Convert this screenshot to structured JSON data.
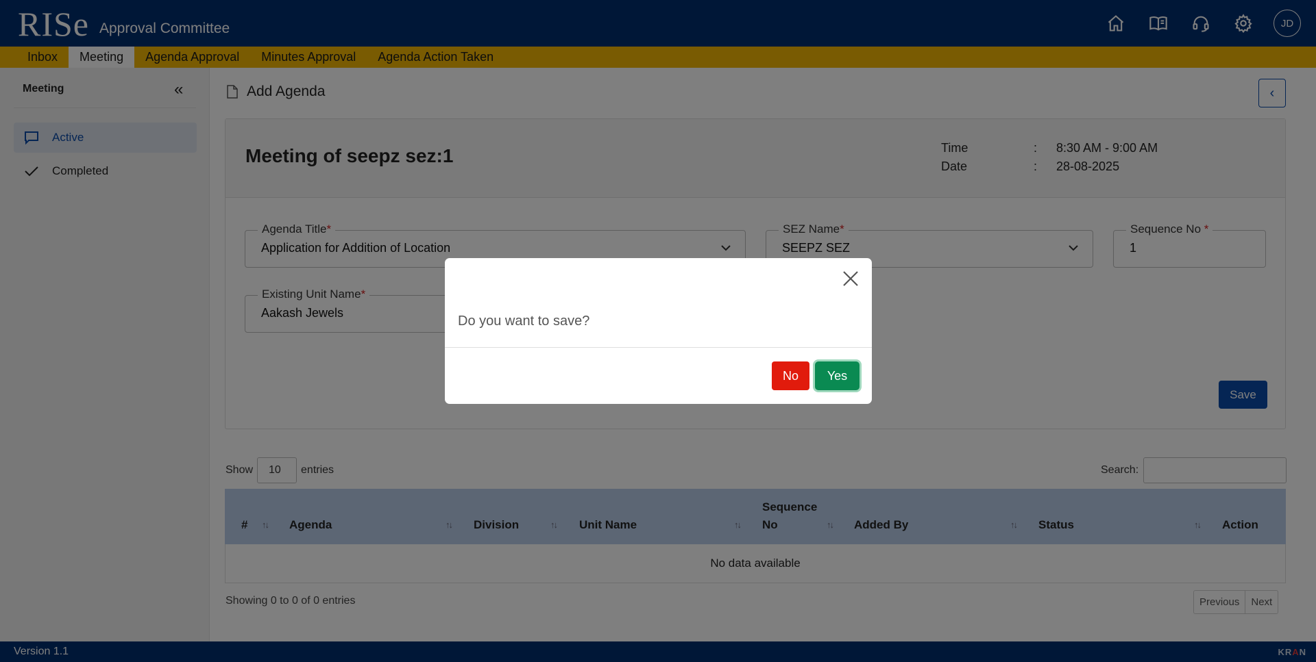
{
  "header": {
    "logo": "RISe",
    "app_name": "Approval Committee",
    "avatar_initials": "JD",
    "icons": [
      "home-icon",
      "book-icon",
      "headset-icon",
      "gear-icon"
    ]
  },
  "menu": {
    "items": [
      {
        "label": "Inbox",
        "active": false
      },
      {
        "label": "Meeting",
        "active": true
      },
      {
        "label": "Agenda Approval",
        "active": false
      },
      {
        "label": "Minutes Approval",
        "active": false
      },
      {
        "label": "Agenda Action Taken",
        "active": false
      }
    ]
  },
  "sidebar": {
    "title": "Meeting",
    "collapse_glyph": "«",
    "items": [
      {
        "label": "Active",
        "icon": "chat-icon",
        "active": true
      },
      {
        "label": "Completed",
        "icon": "check-icon",
        "active": false
      }
    ]
  },
  "page": {
    "title": "Add Agenda",
    "back_glyph": "‹"
  },
  "meeting": {
    "title": "Meeting of seepz sez:1",
    "time_label": "Time",
    "time_value": "8:30 AM - 9:00 AM",
    "date_label": "Date",
    "date_value": "28-08-2025",
    "separator": ":"
  },
  "form": {
    "required_mark": "*",
    "agenda_title": {
      "label": "Agenda Title",
      "value": "Application for Addition of Location"
    },
    "sez_name": {
      "label": "SEZ Name",
      "value": "SEEPZ SEZ"
    },
    "sequence_no": {
      "label": "Sequence No ",
      "value": "1"
    },
    "existing_unit": {
      "label": "Existing Unit Name",
      "value": "Aakash Jewels"
    },
    "save_label": "Save"
  },
  "table": {
    "show_label": "Show",
    "entries_value": "10",
    "entries_label": "entries",
    "search_label": "Search:",
    "columns": [
      "#",
      "Agenda",
      "Division",
      "Unit Name",
      "Sequence",
      "No",
      "Added By",
      "Status",
      "Action"
    ],
    "sort_glyph": "↑↓",
    "empty_text": "No data available",
    "showing_text": "Showing 0 to 0 of 0 entries",
    "prev_label": "Previous",
    "next_label": "Next"
  },
  "footer": {
    "version": "Version 1.1",
    "brand_left": "KR",
    "brand_mid": "A",
    "brand_right": "N"
  },
  "modal": {
    "message": "Do you want to save?",
    "no_label": "No",
    "yes_label": "Yes",
    "no_color": "#e11b0c",
    "yes_color": "#0a8a52"
  }
}
